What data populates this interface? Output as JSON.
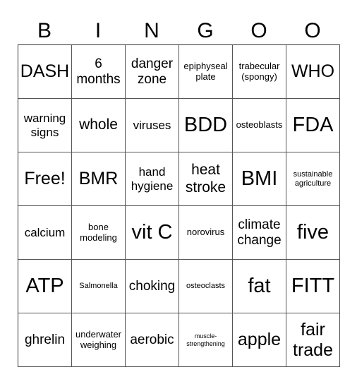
{
  "header": [
    "B",
    "I",
    "N",
    "G",
    "O",
    "O"
  ],
  "cells": [
    [
      "DASH",
      "6 months",
      "danger zone",
      "epiphyseal plate",
      "trabecular (spongy)",
      "WHO"
    ],
    [
      "warning signs",
      "whole",
      "viruses",
      "BDD",
      "osteoblasts",
      "FDA"
    ],
    [
      "Free!",
      "BMR",
      "hand hygiene",
      "heat stroke",
      "BMI",
      "sustainable agriculture"
    ],
    [
      "calcium",
      "bone modeling",
      "vit C",
      "norovirus",
      "climate change",
      "five"
    ],
    [
      "ATP",
      "Salmonella",
      "choking",
      "osteoclasts",
      "fat",
      "FITT"
    ],
    [
      "ghrelin",
      "underwater weighing",
      "aerobic",
      "muscle-strengthening",
      "apple",
      "fair trade"
    ]
  ]
}
